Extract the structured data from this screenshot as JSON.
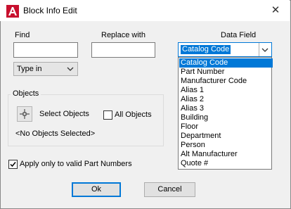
{
  "window": {
    "title": "Block Info Edit",
    "close_glyph": "✕",
    "app_icon": "autocad-a-icon",
    "accent": "#0078d7",
    "brand_red": "#c8102e"
  },
  "find": {
    "label": "Find",
    "value": "",
    "mode_value": "Type in"
  },
  "replace": {
    "label": "Replace with",
    "value": ""
  },
  "data_field": {
    "label": "Data Field",
    "selected": "Catalog Code",
    "options": [
      "Catalog Code",
      "Part Number",
      "Manufacturer Code",
      "Alias 1",
      "Alias 2",
      "Alias 3",
      "Building",
      "Floor",
      "Department",
      "Person",
      "Alt Manufacturer",
      "Quote #"
    ]
  },
  "objects": {
    "group_label": "Objects",
    "select_label": "Select Objects",
    "all_label": "All Objects",
    "all_checked": false,
    "status": "<No Objects Selected>"
  },
  "apply_only": {
    "label": "Apply only to valid Part Numbers",
    "checked": true
  },
  "buttons": {
    "ok": "Ok",
    "cancel": "Cancel"
  }
}
